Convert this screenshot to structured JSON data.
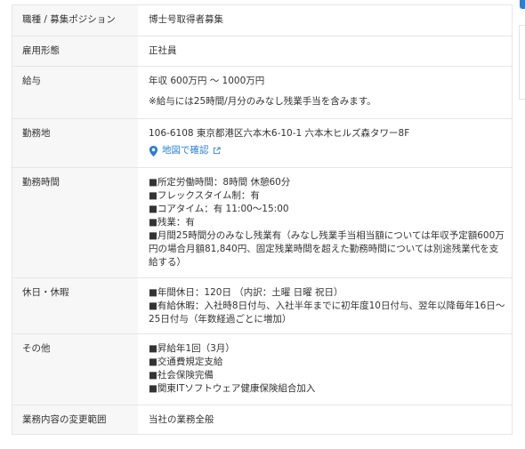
{
  "rows": [
    {
      "label": "職種 / 募集ポジション",
      "lines": [
        "博士号取得者募集"
      ]
    },
    {
      "label": "雇用形態",
      "lines": [
        "正社員"
      ]
    },
    {
      "label": "給与",
      "lines": [
        "年収 600万円 ～ 1000万円",
        "※給与には25時間/月分のみなし残業手当を含みます。"
      ]
    },
    {
      "label": "勤務地",
      "lines": [
        "106-6108 東京都港区六本木6-10-1 六本木ヒルズ森タワー8F"
      ],
      "link": "地図で確認"
    },
    {
      "label": "勤務時間",
      "lines": [
        "■所定労働時間：8時間 休憩60分",
        "■フレックスタイム制：有",
        "■コアタイム：有 11:00～15:00",
        "■残業：有",
        "■月間25時間分のみなし残業有（みなし残業手当相当額については年収予定額600万円の場合月額81,840円、固定残業時間を超えた勤務時間については別途残業代を支給する）"
      ]
    },
    {
      "label": "休日・休暇",
      "lines": [
        "■年間休日：120日 （内訳：土曜 日曜 祝日）",
        "■有給休暇：入社時8日付与、入社半年までに初年度10日付与、翌年以降毎年16日～25日付与（年数経過ごとに増加）"
      ]
    },
    {
      "label": "その他",
      "lines": [
        "■昇給年1回（3月）",
        "■交通費規定支給",
        "■社会保険完備",
        "■関東ITソフトウェア健康保険組合加入"
      ]
    },
    {
      "label": "業務内容の変更範囲",
      "lines": [
        "当社の業務全般"
      ]
    }
  ],
  "icons": {
    "map": "map-pin-icon",
    "external": "external-link-icon"
  },
  "colors": {
    "link": "#2a7fd0",
    "label_bg": "#f7f7f7",
    "border": "#e6e6e6"
  }
}
